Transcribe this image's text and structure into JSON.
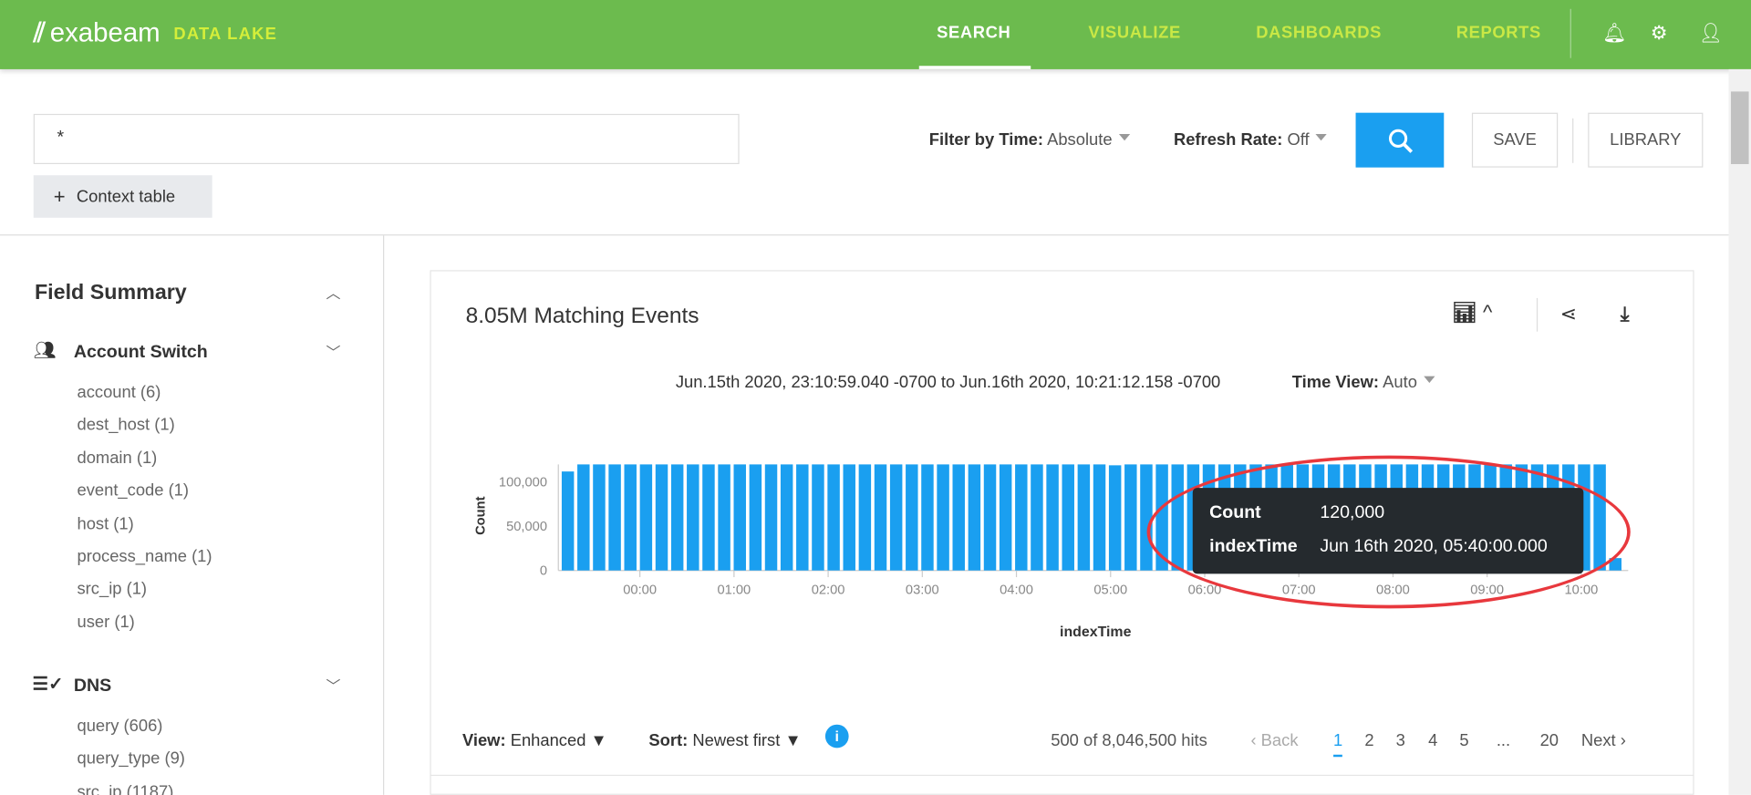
{
  "header": {
    "logo": "exabeam",
    "product": "DATA LAKE",
    "nav": [
      {
        "label": "SEARCH",
        "active": true
      },
      {
        "label": "VISUALIZE"
      },
      {
        "label": "DASHBOARDS"
      },
      {
        "label": "REPORTS"
      }
    ],
    "icons": [
      "bell-icon",
      "gear-icon",
      "user-icon"
    ]
  },
  "search": {
    "query": "*",
    "filter_label": "Filter by Time:",
    "filter_value": "Absolute",
    "refresh_label": "Refresh Rate:",
    "refresh_value": "Off",
    "save": "SAVE",
    "library": "LIBRARY",
    "context_table": "Context table"
  },
  "sidebar": {
    "title": "Field Summary",
    "groups": [
      {
        "name": "Account Switch",
        "icon": "users-icon",
        "fields": [
          "account (6)",
          "dest_host (1)",
          "domain (1)",
          "event_code (1)",
          "host (1)",
          "process_name (1)",
          "src_ip (1)",
          "user (1)"
        ]
      },
      {
        "name": "DNS",
        "icon": "list-check-icon",
        "fields": [
          "query (606)",
          "query_type (9)",
          "src_ip (1187)"
        ]
      }
    ]
  },
  "main": {
    "title": "8.05M Matching Events",
    "range": "Jun.15th 2020, 23:10:59.040 -0700 to Jun.16th 2020, 10:21:12.158 -0700",
    "time_view_label": "Time View:",
    "time_view_value": "Auto",
    "tooltip": {
      "k1": "Count",
      "v1": "120,000",
      "k2": "indexTime",
      "v2": "Jun 16th 2020, 05:40:00.000"
    },
    "view_label": "View:",
    "view_value": "Enhanced",
    "sort_label": "Sort:",
    "sort_value": "Newest first",
    "hits": "500 of 8,046,500 hits",
    "back": "Back",
    "next": "Next",
    "pages": [
      "1",
      "2",
      "3",
      "4",
      "5",
      "...",
      "20"
    ],
    "current_page": "1"
  },
  "chart_data": {
    "type": "bar",
    "xlabel": "indexTime",
    "ylabel": "Count",
    "ylim": [
      0,
      120000
    ],
    "yticks": [
      "0",
      "50,000",
      "100,000"
    ],
    "xticks": [
      "00:00",
      "01:00",
      "02:00",
      "03:00",
      "04:00",
      "05:00",
      "06:00",
      "07:00",
      "08:00",
      "09:00",
      "10:00"
    ],
    "bucket": "10 minutes",
    "first_bucket": "23:10",
    "values": [
      112000,
      120000,
      120000,
      120000,
      120000,
      120000,
      120000,
      120000,
      120000,
      120000,
      120000,
      120000,
      120000,
      120000,
      120000,
      120000,
      120000,
      120000,
      120000,
      120000,
      120000,
      120000,
      120000,
      120000,
      120000,
      120000,
      120000,
      120000,
      120000,
      120000,
      120000,
      120000,
      120000,
      120000,
      120000,
      119000,
      120000,
      120000,
      120000,
      120000,
      120000,
      120000,
      120000,
      120000,
      120000,
      120000,
      120000,
      120000,
      120000,
      120000,
      120000,
      120000,
      120000,
      120000,
      120000,
      120000,
      120000,
      120000,
      120000,
      120000,
      120000,
      120000,
      120000,
      120000,
      120000,
      120000,
      120000,
      14000
    ],
    "color": "#1a9ff0"
  },
  "colors": {
    "header": "#6cbb4e",
    "accent": "#1a9ff0",
    "highlight": "#e8383d"
  }
}
